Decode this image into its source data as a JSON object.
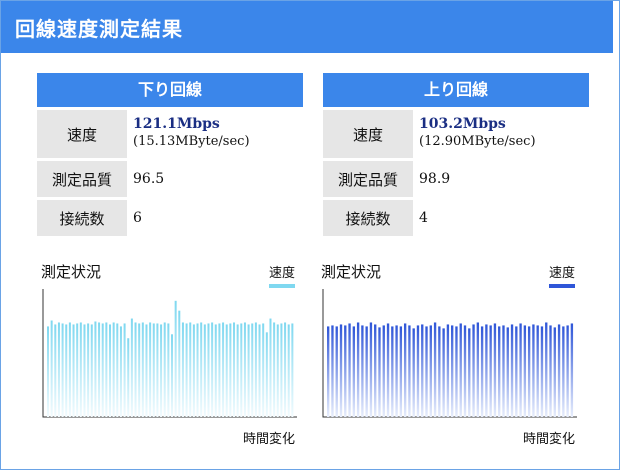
{
  "title": "回線速度測定結果",
  "download": {
    "header": "下り回線",
    "speed_label": "速度",
    "speed_main": "121.1Mbps",
    "speed_sub": "(15.13MByte/sec)",
    "quality_label": "測定品質",
    "quality_value": "96.5",
    "conn_label": "接続数",
    "conn_value": "6"
  },
  "upload": {
    "header": "上り回線",
    "speed_label": "速度",
    "speed_main": "103.2Mbps",
    "speed_sub": "(12.90MByte/sec)",
    "quality_label": "測定品質",
    "quality_value": "98.9",
    "conn_label": "接続数",
    "conn_value": "4"
  },
  "chart_data": [
    {
      "type": "bar",
      "title": "測定状況",
      "legend": [
        "速度"
      ],
      "xlabel": "時間変化",
      "color": "#7fd8f0",
      "values": [
        92,
        98,
        94,
        96,
        95,
        94,
        96,
        94,
        95,
        96,
        94,
        95,
        94,
        97,
        96,
        95,
        96,
        94,
        96,
        95,
        92,
        95,
        80,
        100,
        96,
        95,
        96,
        94,
        96,
        95,
        95,
        94,
        96,
        95,
        84,
        118,
        108,
        96,
        95,
        96,
        94,
        95,
        96,
        94,
        95,
        96,
        94,
        95,
        96,
        94,
        95,
        96,
        94,
        95,
        96,
        94,
        95,
        96,
        94,
        95,
        86,
        100,
        96,
        94,
        95,
        96,
        94,
        95
      ]
    },
    {
      "type": "bar",
      "title": "測定状況",
      "legend": [
        "速度"
      ],
      "xlabel": "時間変化",
      "color": "#2f56d8",
      "values": [
        92,
        93,
        92,
        94,
        93,
        95,
        92,
        96,
        93,
        92,
        96,
        94,
        91,
        93,
        95,
        92,
        93,
        92,
        95,
        93,
        90,
        93,
        94,
        92,
        93,
        96,
        92,
        90,
        94,
        93,
        92,
        95,
        93,
        90,
        94,
        96,
        92,
        94,
        93,
        95,
        92,
        93,
        91,
        94,
        92,
        95,
        93,
        92,
        94,
        93,
        92,
        96,
        93,
        91,
        94,
        92,
        93,
        95
      ]
    }
  ]
}
